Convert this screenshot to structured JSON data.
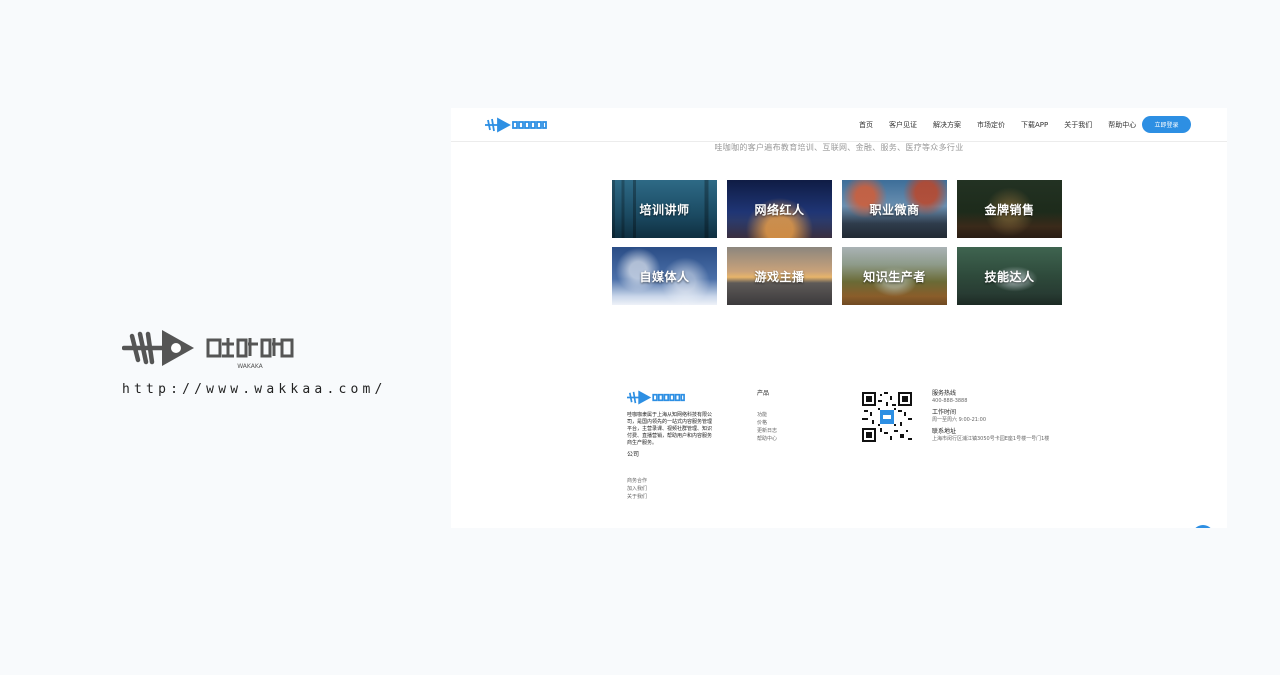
{
  "brand": {
    "logo_text": "哇咖咖",
    "logo_sub": "WAKAKA",
    "url": "http://www.wakkaa.com/"
  },
  "nav": {
    "logo_text": "哇咖咖",
    "links": [
      "首页",
      "客户见证",
      "解决方案",
      "市场定价",
      "下载APP",
      "关于我们",
      "帮助中心"
    ],
    "cta": "立即登录"
  },
  "subtitle": "哇咖咖的客户遍布教育培训、互联网、金融、服务、医疗等众多行业",
  "tiles": [
    "培训讲师",
    "网络红人",
    "职业微商",
    "金牌销售",
    "自媒体人",
    "游戏主播",
    "知识生产者",
    "技能达人"
  ],
  "footer": {
    "logo_text": "哇咖咖",
    "description": "哇咖咖隶属于上海从知网络科技有限公司，是国内领先的一站式内容服务管理平台，主营录课、视频社群管理、知识付费、直播营销，帮助用户和内容服务商生产服务。",
    "description_tail": "公司",
    "company_links": [
      "商务合作",
      "加入我们",
      "关于我们"
    ],
    "product_title": "产品",
    "product_links": [
      "功能",
      "价格",
      "更新日志",
      "帮助中心"
    ],
    "hotline_label": "服务热线",
    "hotline": "400-888-3888",
    "hours_label": "工作时间",
    "hours": "周一至周六 9:00-21:00",
    "address_label": "联系地址",
    "address": "上海市闵行区浦江镇3050号卡园E座1号楼一号门1楼"
  },
  "colors": {
    "accent": "#2d8fe3",
    "logo_dark": "#555555",
    "page_bg": "#f8fafc"
  }
}
